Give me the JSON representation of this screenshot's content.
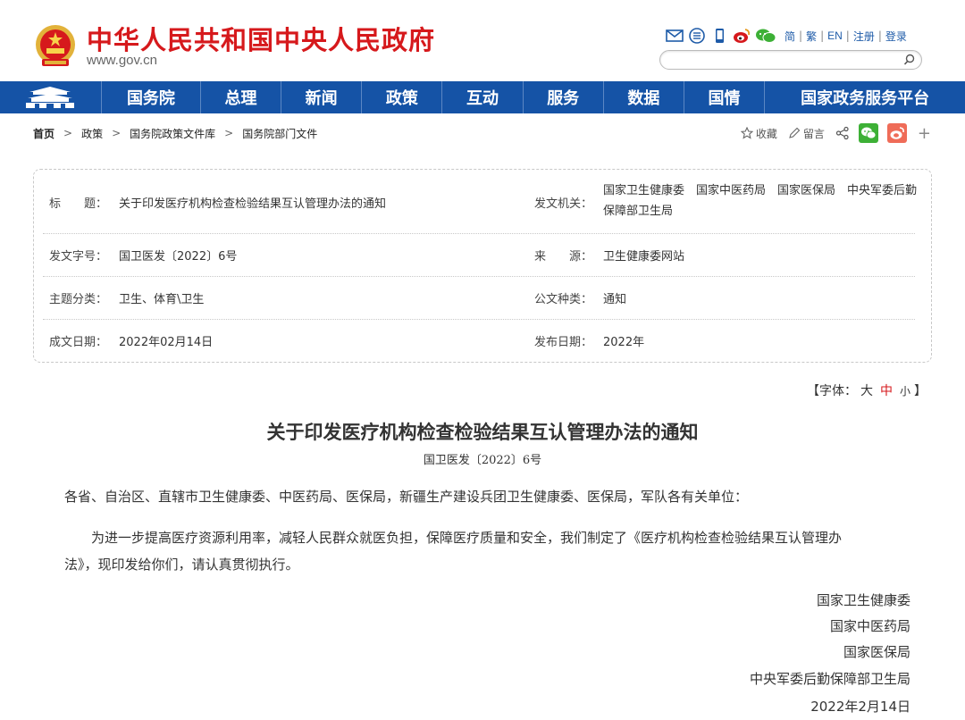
{
  "header": {
    "site_title": "中华人民共和国中央人民政府",
    "site_url": "www.gov.cn",
    "lang_links": [
      "简",
      "繁",
      "EN",
      "注册",
      "登录"
    ],
    "icons": [
      "mail-icon",
      "rss-icon",
      "mobile-icon",
      "weibo-icon",
      "wechat-icon"
    ],
    "search_placeholder": ""
  },
  "nav": {
    "home_icon": "tiananmen-icon",
    "items": [
      "国务院",
      "总理",
      "新闻",
      "政策",
      "互动",
      "服务",
      "数据",
      "国情",
      "国家政务服务平台"
    ]
  },
  "breadcrumb": {
    "items": [
      "首页",
      "政策",
      "国务院政策文件库",
      "国务院部门文件"
    ],
    "separator": ">"
  },
  "share": {
    "favorite_label": "收藏",
    "comment_label": "留言"
  },
  "info": {
    "title_label": "标　　题：",
    "title_value": "关于印发医疗机构检查检验结果互认管理办法的通知",
    "issuer_label": "发文机关：",
    "issuer_value": "国家卫生健康委　国家中医药局　国家医保局　中央军委后勤保障部卫生局",
    "doc_no_label": "发文字号：",
    "doc_no_value": "国卫医发〔2022〕6号",
    "source_label": "来　　源：",
    "source_value": "卫生健康委网站",
    "category_label": "主题分类：",
    "category_value": "卫生、体育\\卫生",
    "doctype_label": "公文种类：",
    "doctype_value": "通知",
    "date_label": "成文日期：",
    "date_value": "2022年02月14日",
    "publish_label": "发布日期：",
    "publish_value": "2022年"
  },
  "font_size": {
    "prefix": "【字体：",
    "large": "大",
    "medium": "中",
    "small": "小",
    "suffix": "】"
  },
  "article": {
    "title": "关于印发医疗机构检查检验结果互认管理办法的通知",
    "doc_number": "国卫医发〔2022〕6号",
    "salutation": "各省、自治区、直辖市卫生健康委、中医药局、医保局，新疆生产建设兵团卫生健康委、医保局，军队各有关单位：",
    "body_line1": "　　为进一步提高医疗资源利用率，减轻人民群众就医负担，保障医疗质量和安全，我们制定了《医疗机构检查检验结果互认管理办",
    "body_line2": "法》，现印发给你们，请认真贯彻执行。",
    "signatures": [
      "国家卫生健康委",
      "国家中医药局",
      "国家医保局",
      "中央军委后勤保障部卫生局"
    ],
    "sign_date": "2022年2月14日"
  },
  "colors": {
    "brand_red": "#d6191c",
    "nav_blue": "#1553a6",
    "link_blue": "#1e5ba8",
    "wechat_green": "#3db036",
    "weibo_red": "#ef6c58"
  }
}
